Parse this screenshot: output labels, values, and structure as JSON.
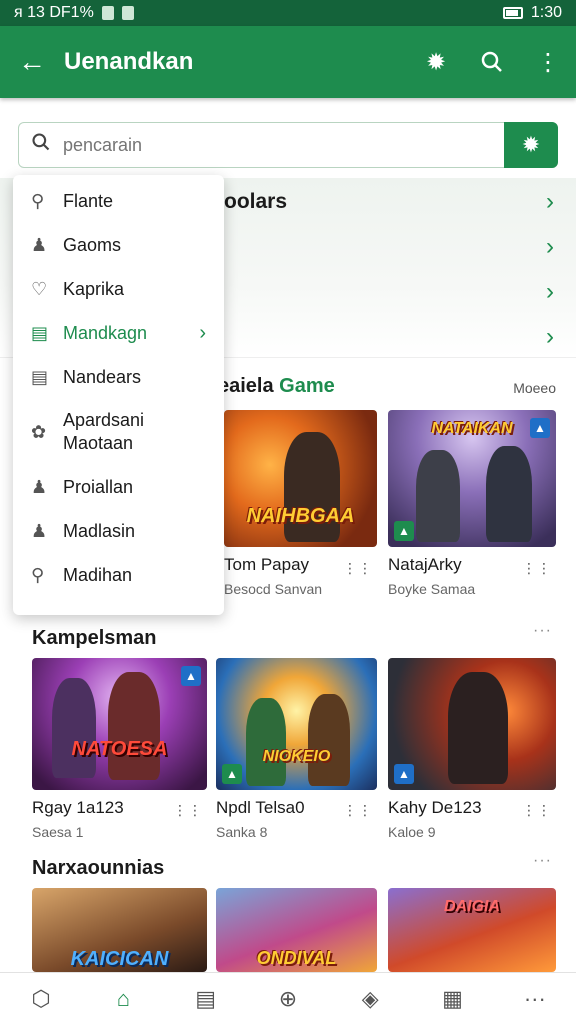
{
  "status_bar": {
    "left_text": "ᴙ 13 DF1%",
    "time": "1:30"
  },
  "app_bar": {
    "title": "Uenandkan"
  },
  "search": {
    "placeholder": "pencarain"
  },
  "promo": {
    "title": "oolars"
  },
  "dropdown": {
    "items": [
      {
        "label": "Flante",
        "icon": "search-icon"
      },
      {
        "label": "Gaoms",
        "icon": "user-icon"
      },
      {
        "label": "Kaprika",
        "icon": "heart-icon"
      },
      {
        "label": "Mandkagn",
        "icon": "list-icon",
        "active": true
      },
      {
        "label": "Nandears",
        "icon": "document-icon"
      },
      {
        "label": "Apardsani\nMaotaan",
        "icon": "puzzle-icon"
      },
      {
        "label": "Proiallan",
        "icon": "user-icon"
      },
      {
        "label": "Madlasin",
        "icon": "user-icon"
      },
      {
        "label": "Madihan",
        "icon": "search-icon"
      }
    ]
  },
  "section1": {
    "title_prefix": "eaiela",
    "title_highlight": "Game",
    "more": "Moeeo",
    "cards": [
      {
        "art_text": "NAIHBGAA",
        "name": "Tom Papay",
        "sub": "Besocd Sanvan"
      },
      {
        "art_text": "NATAIKAN",
        "name": "NatajArky",
        "sub": "Boyke Samaa"
      }
    ]
  },
  "section2": {
    "title": "Kampelsman",
    "cards": [
      {
        "art_text": "NATOESA",
        "name": "Rgay 1a123",
        "sub": "Saesa 1"
      },
      {
        "art_text": "NIOKEIO",
        "name": "Npdl Telsa0",
        "sub": "Sanka 8"
      },
      {
        "art_text": "",
        "name": "Kahy De123",
        "sub": "Kaloe 9"
      }
    ]
  },
  "section3": {
    "title": "Narxaounnias",
    "cards": [
      {
        "art_text": "KAICICAN"
      },
      {
        "art_text": "ONDIVAL"
      },
      {
        "art_text": "DAIGIA"
      }
    ]
  },
  "bottom_nav": [
    {
      "icon": "box-icon"
    },
    {
      "icon": "home-icon",
      "active": true
    },
    {
      "icon": "library-icon"
    },
    {
      "icon": "download-icon"
    },
    {
      "icon": "tag-icon"
    },
    {
      "icon": "grid-icon"
    },
    {
      "icon": "more-icon"
    }
  ],
  "colors": {
    "primary": "#1e8c4e",
    "status_bar": "#14633a",
    "accent_blue": "#1f6fc7"
  }
}
